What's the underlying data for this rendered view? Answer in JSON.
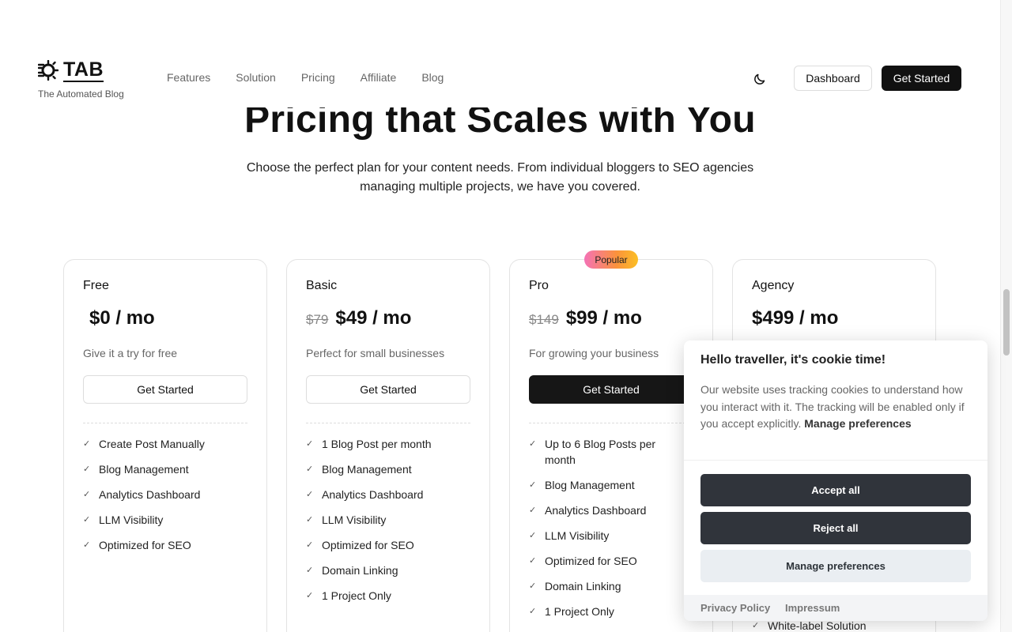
{
  "header": {
    "logo_text": "TAB",
    "logo_subtitle": "The Automated Blog",
    "nav": [
      "Features",
      "Solution",
      "Pricing",
      "Affiliate",
      "Blog"
    ],
    "dashboard_label": "Dashboard",
    "get_started_label": "Get Started"
  },
  "hero": {
    "title": "Pricing that Scales with You",
    "subtitle": "Choose the perfect plan for your content needs. From individual bloggers to SEO agencies managing multiple projects, we have you covered."
  },
  "plans": [
    {
      "name": "Free",
      "old_price": "",
      "price": "$0 / mo",
      "description": "Give it a try for free",
      "button": "Get Started",
      "features": [
        "Create Post Manually",
        "Blog Management",
        "Analytics Dashboard",
        "LLM Visibility",
        "Optimized for SEO"
      ]
    },
    {
      "name": "Basic",
      "old_price": "$79",
      "price": "$49 / mo",
      "description": "Perfect for small businesses",
      "button": "Get Started",
      "features": [
        "1 Blog Post per month",
        "Blog Management",
        "Analytics Dashboard",
        "LLM Visibility",
        "Optimized for SEO",
        "Domain Linking",
        "1 Project Only"
      ]
    },
    {
      "name": "Pro",
      "badge": "Popular",
      "old_price": "$149",
      "price": "$99 / mo",
      "description": "For growing your business",
      "button": "Get Started",
      "features": [
        "Up to 6 Blog Posts per month",
        "Blog Management",
        "Analytics Dashboard",
        "LLM Visibility",
        "Optimized for SEO",
        "Domain Linking",
        "1 Project Only"
      ]
    },
    {
      "name": "Agency",
      "old_price": "",
      "price": "$499 / mo",
      "visible_feature": "White-label Solution"
    }
  ],
  "cookie": {
    "title": "Hello traveller, it's cookie time!",
    "text": "Our website uses tracking cookies to understand how you interact with it. The tracking will be enabled only if you accept explicitly.",
    "manage_link": "Manage preferences",
    "accept_all": "Accept all",
    "reject_all": "Reject all",
    "manage_preferences": "Manage preferences",
    "privacy_policy": "Privacy Policy",
    "impressum": "Impressum"
  }
}
